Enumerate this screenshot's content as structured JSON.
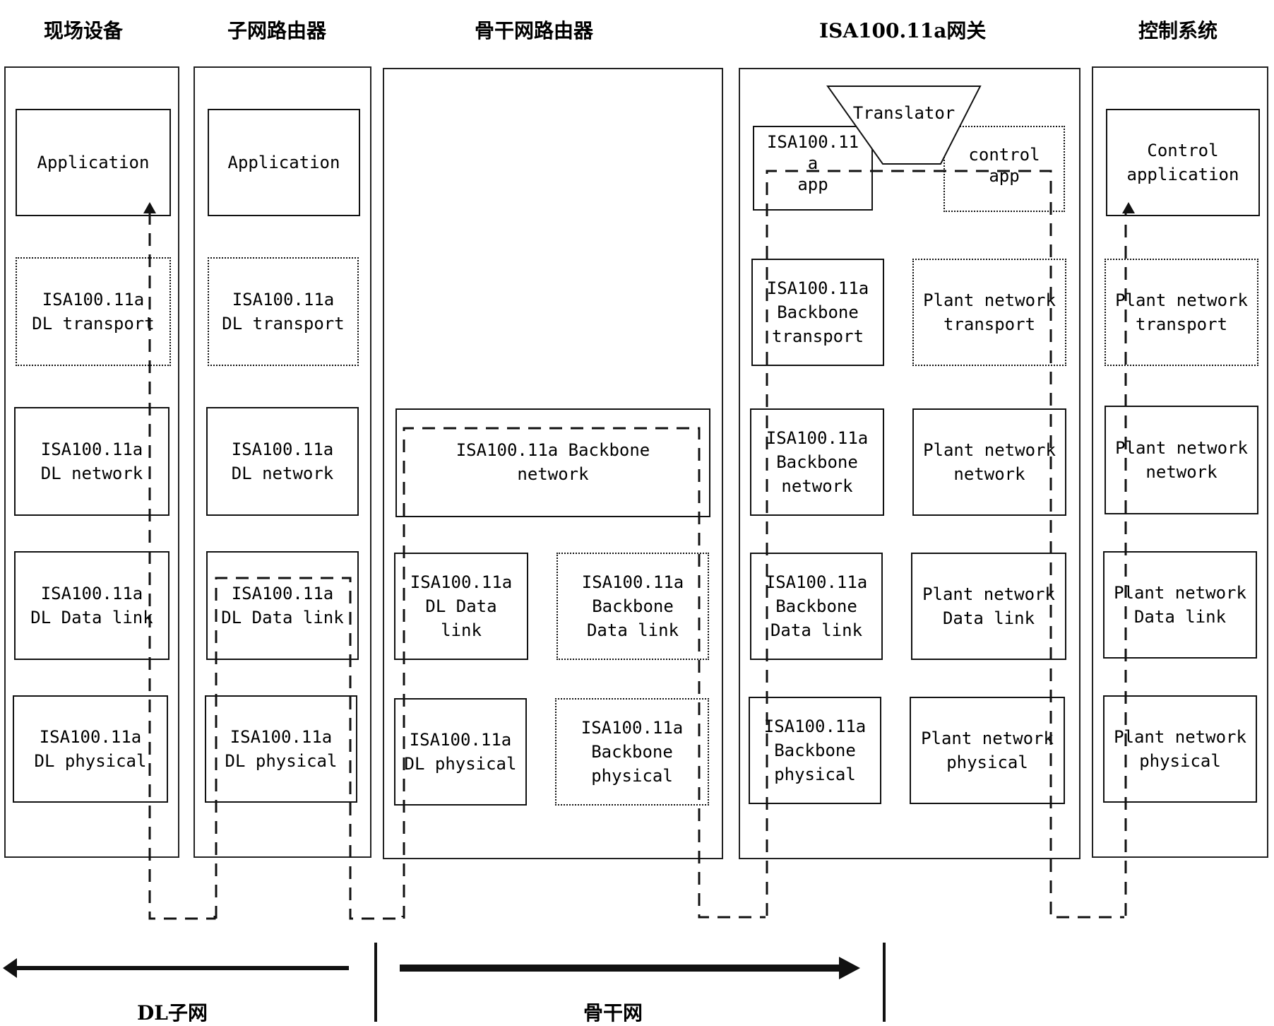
{
  "columns": [
    {
      "id": "field-device",
      "title": "现场设备",
      "layers": [
        "Application",
        "ISA100.11a\nDL transport",
        "ISA100.11a\nDL network",
        "ISA100.11a\nDL Data link",
        "ISA100.11a\nDL physical"
      ]
    },
    {
      "id": "subnet-router",
      "title": "子网路由器",
      "layers": [
        "Application",
        "ISA100.11a\nDL transport",
        "ISA100.11a\nDL network",
        "ISA100.11a\nDL Data link",
        "ISA100.11a\nDL physical"
      ]
    },
    {
      "id": "backbone-router",
      "title": "骨干网路由器",
      "layers": [
        "ISA100.11a Backbone\nnetwork",
        "ISA100.11a\nDL Data\nlink",
        "ISA100.11a\nBackbone\nData link",
        "ISA100.11a\nDL physical",
        "ISA100.11a\nBackbone\nphysical"
      ]
    },
    {
      "id": "gateway",
      "title": "ISA100.11a网关",
      "translator": "Translator",
      "app_left": "ISA100.11\na\napp",
      "app_right": "control\napp",
      "layers": [
        "ISA100.11a\nBackbone\ntransport",
        "Plant network\ntransport",
        "ISA100.11a\nBackbone\nnetwork",
        "Plant network\nnetwork",
        "ISA100.11a\nBackbone\nData link",
        "Plant network\nData link",
        "ISA100.11a\nBackbone\nphysical",
        "Plant network\nphysical"
      ]
    },
    {
      "id": "control-system",
      "title": "控制系统",
      "layers": [
        "Control\napplication",
        "Plant network\ntransport",
        "Plant network\nnetwork",
        "Plant network\nData link",
        "Plant network\nphysical"
      ]
    }
  ],
  "regions": [
    {
      "id": "dl-subnet",
      "label": "DL子网",
      "direction": "left"
    },
    {
      "id": "backbone",
      "label": "骨干网",
      "direction": "right"
    }
  ]
}
